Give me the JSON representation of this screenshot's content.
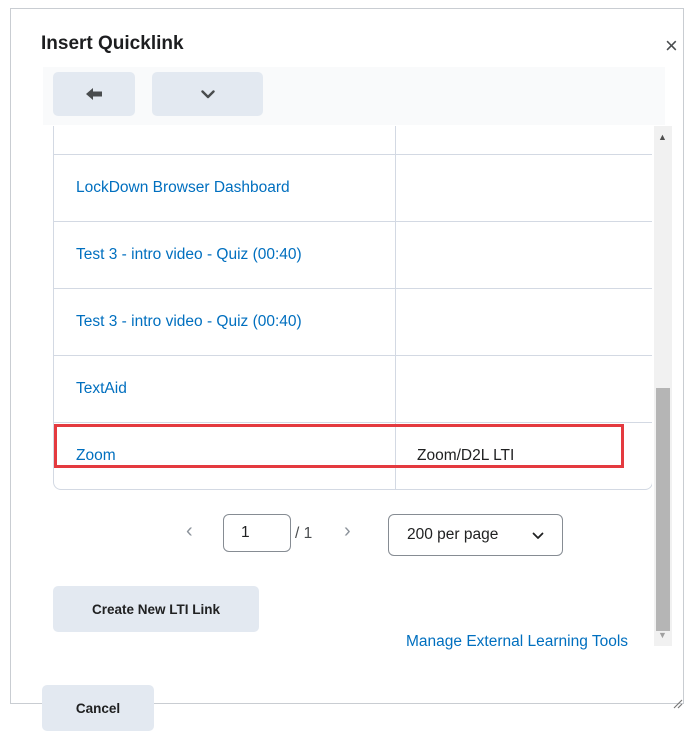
{
  "dialog": {
    "title": "Insert Quicklink",
    "close_label": "×"
  },
  "toolbar": {
    "back_icon": "back-arrow-icon",
    "menu_icon": "chevron-down-icon"
  },
  "table": {
    "rows": [
      {
        "name": "",
        "type": ""
      },
      {
        "name": "LockDown Browser Dashboard",
        "type": ""
      },
      {
        "name": "Test 3 - intro video - Quiz (00:40)",
        "type": ""
      },
      {
        "name": "Test 3 - intro video - Quiz (00:40)",
        "type": ""
      },
      {
        "name": "TextAid",
        "type": ""
      },
      {
        "name": "Zoom",
        "type": "Zoom/D2L LTI"
      }
    ],
    "highlighted_row": "Zoom"
  },
  "pager": {
    "prev": "‹",
    "page_value": "1",
    "of_label": "/ 1",
    "next": "›",
    "per_page": "200 per page"
  },
  "create_button": "Create New LTI Link",
  "manage_link": "Manage External Learning Tools",
  "cancel_button": "Cancel",
  "colors": {
    "link": "#006fbf",
    "highlight": "#e43a3f",
    "button_bg": "#e3e9f1"
  }
}
